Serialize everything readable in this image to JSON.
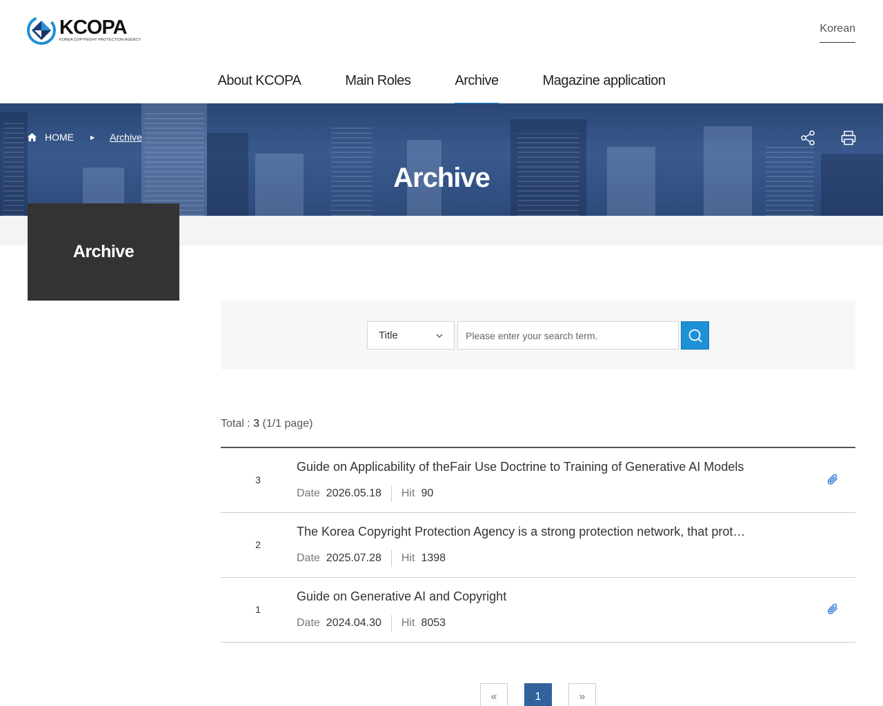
{
  "brand": {
    "name": "KCOPA",
    "subtitle": "KOREA COPYRIGHT PROTECTION AGENCY",
    "primary_color": "#1e90d6"
  },
  "header": {
    "language": "Korean",
    "nav": [
      {
        "label": "About KCOPA",
        "active": false
      },
      {
        "label": "Main Roles",
        "active": false
      },
      {
        "label": "Archive",
        "active": true
      },
      {
        "label": "Magazine application",
        "active": false
      }
    ]
  },
  "banner": {
    "breadcrumb": {
      "home": "HOME",
      "current": "Archive"
    },
    "title": "Archive",
    "tools": [
      "share-icon",
      "print-icon"
    ]
  },
  "sidebar": {
    "title": "Archive"
  },
  "search": {
    "field_selected": "Title",
    "placeholder": "Please enter your search term.",
    "button_icon": "search-icon"
  },
  "summary": {
    "label": "Total : ",
    "count": "3",
    "pages": " (1/1 page)"
  },
  "posts": [
    {
      "no": "3",
      "title": "Guide on Applicability of theFair Use Doctrine to Training of Generative AI Models",
      "date_label": "Date",
      "date": "2026.05.18",
      "hit_label": "Hit",
      "hits": "90",
      "has_attachment": true
    },
    {
      "no": "2",
      "title": "The Korea Copyright Protection Agency is a strong protection network, that prot…",
      "date_label": "Date",
      "date": "2025.07.28",
      "hit_label": "Hit",
      "hits": "1398",
      "has_attachment": false
    },
    {
      "no": "1",
      "title": "Guide on Generative AI and Copyright",
      "date_label": "Date",
      "date": "2024.04.30",
      "hit_label": "Hit",
      "hits": "8053",
      "has_attachment": true
    }
  ],
  "pagination": {
    "first": "«",
    "current": "1",
    "last": "»"
  }
}
